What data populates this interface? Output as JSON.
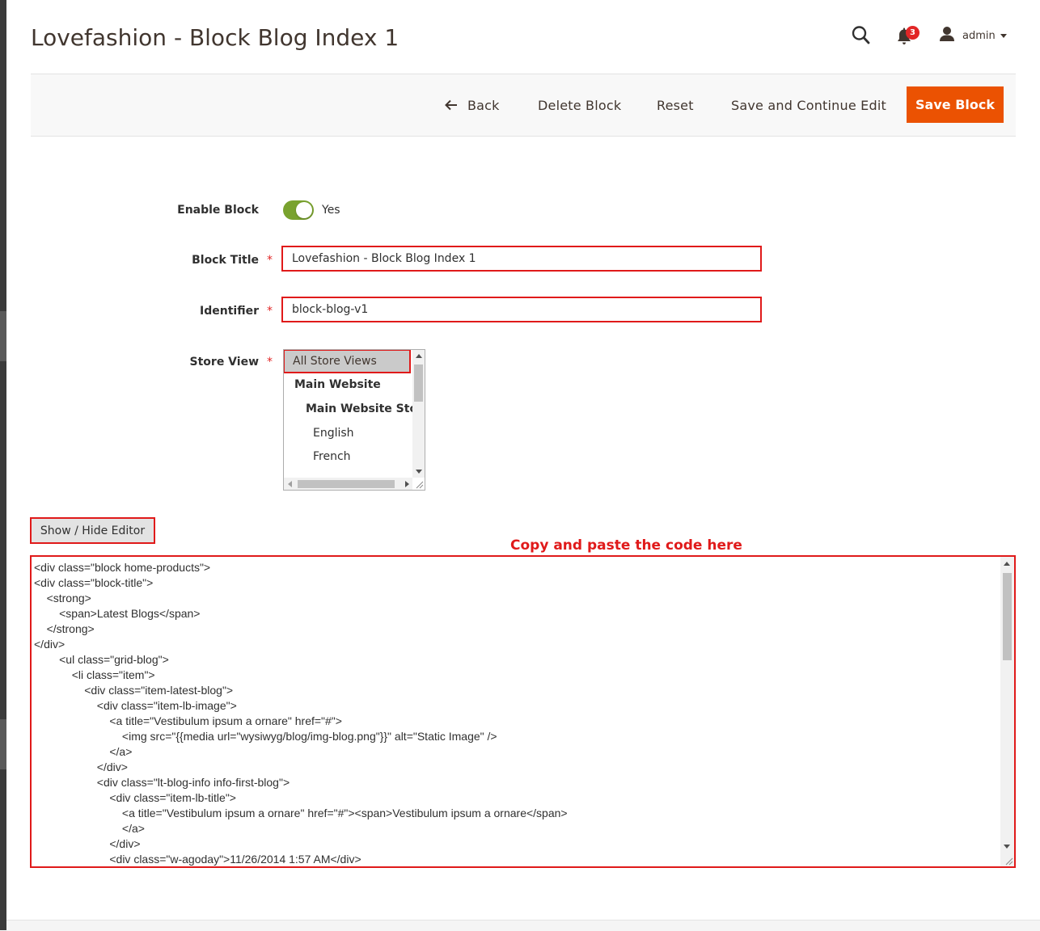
{
  "page": {
    "title": "Lovefashion - Block Blog Index 1"
  },
  "header": {
    "search_icon": "search-icon",
    "notifications_icon": "bell-icon",
    "notifications_count": "3",
    "user_icon": "user-icon",
    "user_name": "admin"
  },
  "toolbar": {
    "back_label": "Back",
    "delete_label": "Delete Block",
    "reset_label": "Reset",
    "save_continue_label": "Save and Continue Edit",
    "save_label": "Save Block",
    "accent_color": "#eb5202"
  },
  "form": {
    "enable": {
      "label": "Enable Block",
      "value": "Yes",
      "enabled": true
    },
    "title": {
      "label": "Block Title",
      "value": "Lovefashion - Block Blog Index 1"
    },
    "identifier": {
      "label": "Identifier",
      "value": "block-blog-v1"
    },
    "store_view": {
      "label": "Store View",
      "options": [
        "All Store Views",
        "Main Website",
        "Main Website Store",
        "English",
        "French"
      ],
      "selected": "All Store Views"
    },
    "required_mark": "*"
  },
  "editor": {
    "toggle_label": "Show / Hide Editor",
    "annotation": "Copy and paste the code here",
    "content": "<div class=\"block home-products\">\n<div class=\"block-title\">\n\t<strong>\n\t\t<span>Latest Blogs</span>\n\t</strong>\n</div>\n\t\t<ul class=\"grid-blog\">\n\t\t\t<li class=\"item\">\n\t\t\t\t<div class=\"item-latest-blog\">\n\t\t\t\t\t<div class=\"item-lb-image\">\n\t\t\t\t\t\t<a title=\"Vestibulum ipsum a ornare\" href=\"#\">\n\t\t\t\t\t\t\t<img src=\"{{media url=\"wysiwyg/blog/img-blog.png\"}}\" alt=\"Static Image\" />\n\t\t\t\t\t\t</a>\n\t\t\t\t\t</div>\n\t\t\t\t\t<div class=\"lt-blog-info info-first-blog\">\n\t\t\t\t\t\t<div class=\"item-lb-title\">\n\t\t\t\t\t\t\t<a title=\"Vestibulum ipsum a ornare\" href=\"#\"><span>Vestibulum ipsum a ornare</span>\n\t\t\t\t\t\t\t</a>\n\t\t\t\t\t\t</div>\n\t\t\t\t\t\t<div class=\"w-agoday\">11/26/2014 1:57 AM</div>"
  }
}
